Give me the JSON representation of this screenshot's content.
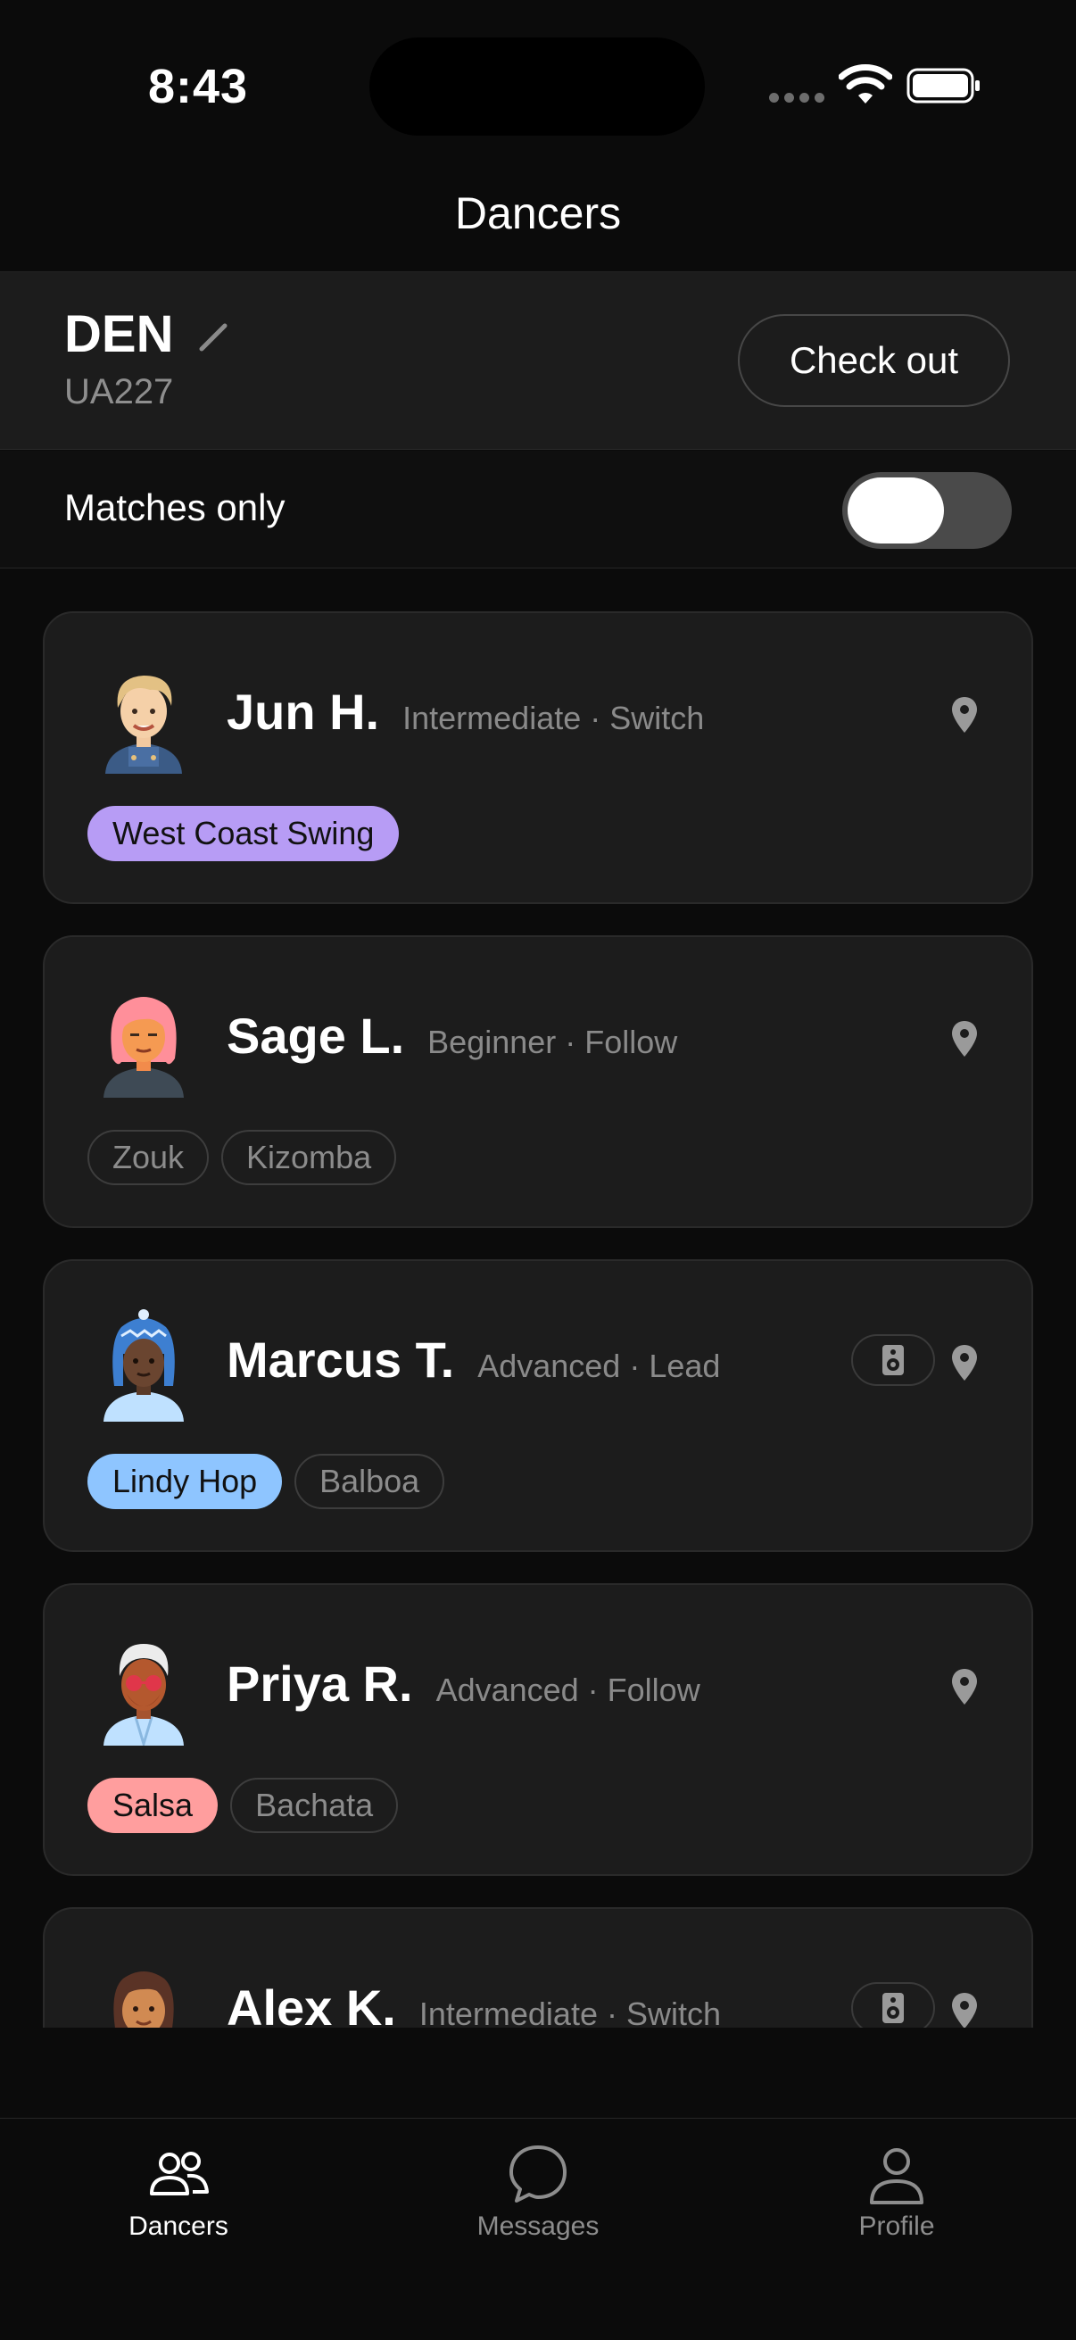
{
  "status_bar": {
    "time": "8:43"
  },
  "header": {
    "title": "Dancers"
  },
  "trip": {
    "code": "DEN",
    "flight": "UA227",
    "checkout_label": "Check out"
  },
  "filter": {
    "label": "Matches only",
    "enabled": false
  },
  "dancers": [
    {
      "name": "Jun H.",
      "meta": "Intermediate · Switch",
      "tags": [
        {
          "label": "West Coast Swing",
          "primary": true,
          "color": "#b79cf5"
        }
      ],
      "speaker": false
    },
    {
      "name": "Sage L.",
      "meta": "Beginner · Follow",
      "tags": [
        {
          "label": "Zouk",
          "primary": false
        },
        {
          "label": "Kizomba",
          "primary": false
        }
      ],
      "speaker": false
    },
    {
      "name": "Marcus T.",
      "meta": "Advanced · Lead",
      "tags": [
        {
          "label": "Lindy Hop",
          "primary": true,
          "color": "#8ec5ff"
        },
        {
          "label": "Balboa",
          "primary": false
        }
      ],
      "speaker": true
    },
    {
      "name": "Priya R.",
      "meta": "Advanced · Follow",
      "tags": [
        {
          "label": "Salsa",
          "primary": true,
          "color": "#ff9e9e"
        },
        {
          "label": "Bachata",
          "primary": false
        }
      ],
      "speaker": false
    },
    {
      "name": "Alex K.",
      "meta": "Intermediate · Switch",
      "tags": [],
      "speaker": true
    }
  ],
  "tabs": [
    {
      "label": "Dancers",
      "icon": "people-icon",
      "active": true
    },
    {
      "label": "Messages",
      "icon": "chat-bubble-icon",
      "active": false
    },
    {
      "label": "Profile",
      "icon": "person-icon",
      "active": false
    }
  ]
}
